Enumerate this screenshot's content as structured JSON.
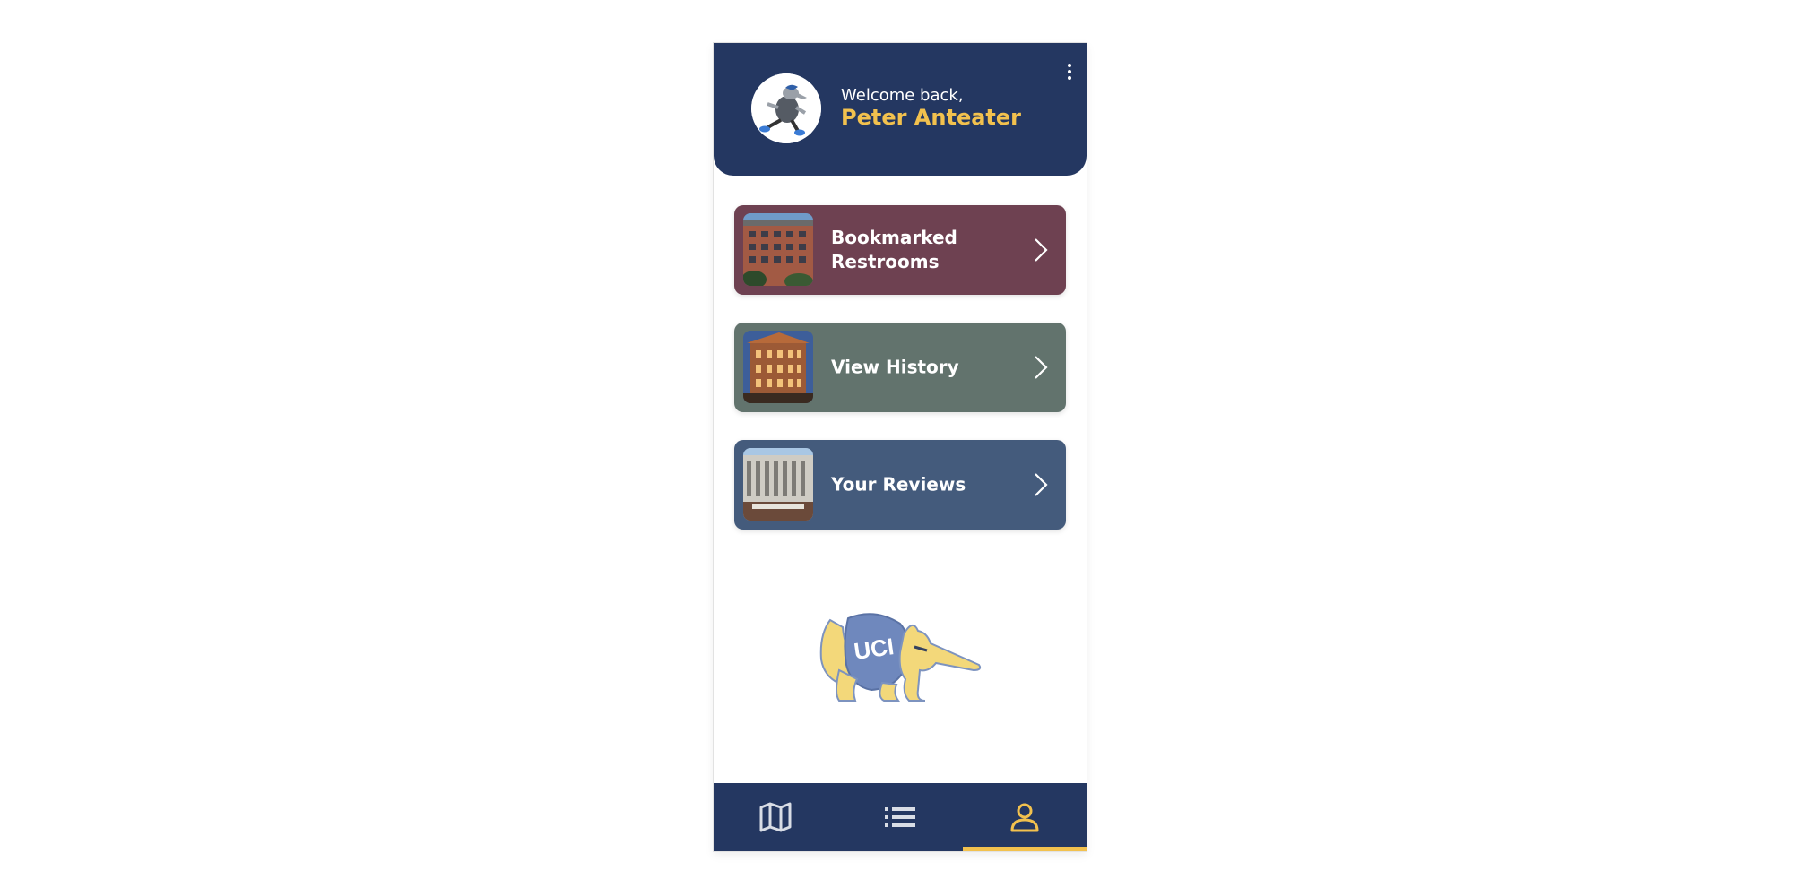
{
  "header": {
    "welcome_text": "Welcome back,",
    "user_name": "Peter Anteater",
    "menu_icon": "more-vertical-icon",
    "avatar_icon": "running-anteater-avatar"
  },
  "menu_cards": [
    {
      "label": "Bookmarked Restrooms",
      "color": "#6e4151",
      "icon": "chevron-right-icon"
    },
    {
      "label": "View History",
      "color": "#62736d",
      "icon": "chevron-right-icon"
    },
    {
      "label": "Your Reviews",
      "color": "#445b7c",
      "icon": "chevron-right-icon"
    }
  ],
  "mascot": {
    "logo_text": "UCI"
  },
  "bottom_nav": {
    "items": [
      {
        "icon": "map-icon",
        "active": false
      },
      {
        "icon": "list-icon",
        "active": false
      },
      {
        "icon": "person-icon",
        "active": true
      }
    ]
  },
  "colors": {
    "primary": "#243761",
    "accent": "#f2c14e"
  }
}
